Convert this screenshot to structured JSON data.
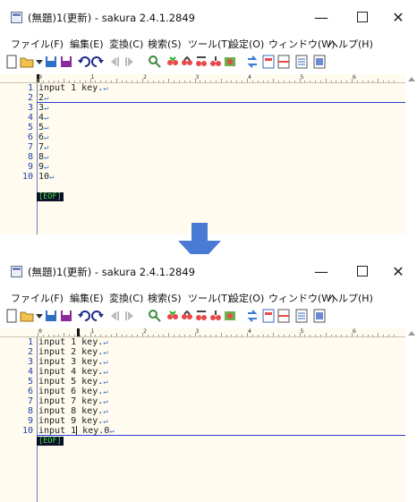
{
  "colors": {
    "editor_bg": "#fffbef",
    "line_number": "#1f3fa6",
    "eol_mark": "#3c78d8",
    "eof_bg": "#0e0e2a",
    "eof_text": "#40e040",
    "arrow": "#4a7bd4"
  },
  "window_common": {
    "title": "(無題)1(更新) - sakura 2.4.1.2849",
    "minimize_glyph": "—",
    "close_glyph": "✕",
    "menu": [
      "ファイル(F)",
      "編集(E)",
      "変換(C)",
      "検索(S)",
      "ツール(T)",
      "設定(O)",
      "ウィンドウ(W)",
      "ヘルプ(H)"
    ],
    "ruler_numbers": [
      "0",
      "1",
      "2",
      "3",
      "4",
      "5",
      "6"
    ],
    "eol_symbol": "↵",
    "eof_label": "[EOF]"
  },
  "before": {
    "lines": [
      {
        "num": "1",
        "text": "input 1 key."
      },
      {
        "num": "2",
        "text": "2"
      },
      {
        "num": "3",
        "text": "3"
      },
      {
        "num": "4",
        "text": "4"
      },
      {
        "num": "5",
        "text": "5"
      },
      {
        "num": "6",
        "text": "6"
      },
      {
        "num": "7",
        "text": "7"
      },
      {
        "num": "8",
        "text": "8"
      },
      {
        "num": "9",
        "text": "9"
      },
      {
        "num": "10",
        "text": "10"
      }
    ]
  },
  "after": {
    "lines": [
      {
        "num": "1",
        "text": "input 1 key."
      },
      {
        "num": "2",
        "text": "input 2 key."
      },
      {
        "num": "3",
        "text": "input 3 key."
      },
      {
        "num": "4",
        "text": "input 4 key."
      },
      {
        "num": "5",
        "text": "input 5 key."
      },
      {
        "num": "6",
        "text": "input 6 key."
      },
      {
        "num": "7",
        "text": "input 7 key."
      },
      {
        "num": "8",
        "text": "input 8 key."
      },
      {
        "num": "9",
        "text": "input 9 key."
      }
    ],
    "last_line": {
      "num": "10",
      "before_caret": "input 1",
      "after_caret": " key.0"
    }
  },
  "toolbar_icons": [
    "new-file-icon",
    "open-folder-icon",
    "dropdown-icon",
    "save-icon",
    "save-all-icon",
    "undo-icon",
    "redo-icon",
    "jump-back-icon",
    "jump-forward-icon",
    "search-icon",
    "search-prev-icon",
    "search-next-icon",
    "replace-icon",
    "find-all-icon",
    "grep-icon",
    "compare-icon",
    "outline-icon",
    "split-icon",
    "print-icon",
    "settings-icon"
  ]
}
